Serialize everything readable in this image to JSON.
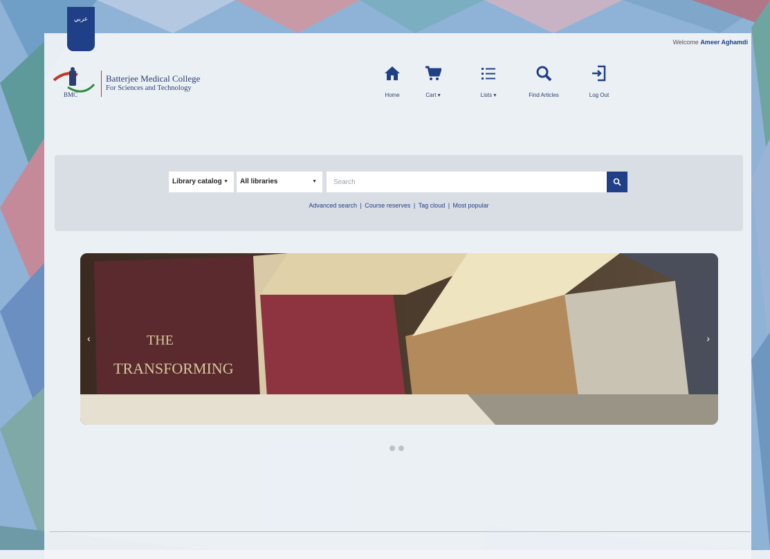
{
  "header": {
    "lang_tab": "عربي",
    "welcome_prefix": "Welcome",
    "welcome_user": "Ameer Aghamdi"
  },
  "logo": {
    "badge": "BMC",
    "line1": "Batterjee Medical College",
    "line2": "For Sciences and Technology"
  },
  "nav": [
    {
      "label": "Home",
      "icon": "home-icon"
    },
    {
      "label": "Cart ▾",
      "icon": "cart-icon"
    },
    {
      "label": "Lists ▾",
      "icon": "list-icon"
    },
    {
      "label": "Find Articles",
      "icon": "search-icon"
    },
    {
      "label": "Log Out",
      "icon": "logout-icon"
    }
  ],
  "search": {
    "catalog_select": "Library catalog",
    "library_select": "All libraries",
    "placeholder": "Search",
    "links": [
      "Advanced search",
      "Course reserves",
      "Tag cloud",
      "Most popular"
    ]
  },
  "carousel": {
    "title_word1": "THE",
    "title_word2": "TRANSFORMING",
    "prev": "‹",
    "next": "›"
  },
  "colors": {
    "primary": "#1f3f86",
    "panel": "#d6dbe2"
  }
}
